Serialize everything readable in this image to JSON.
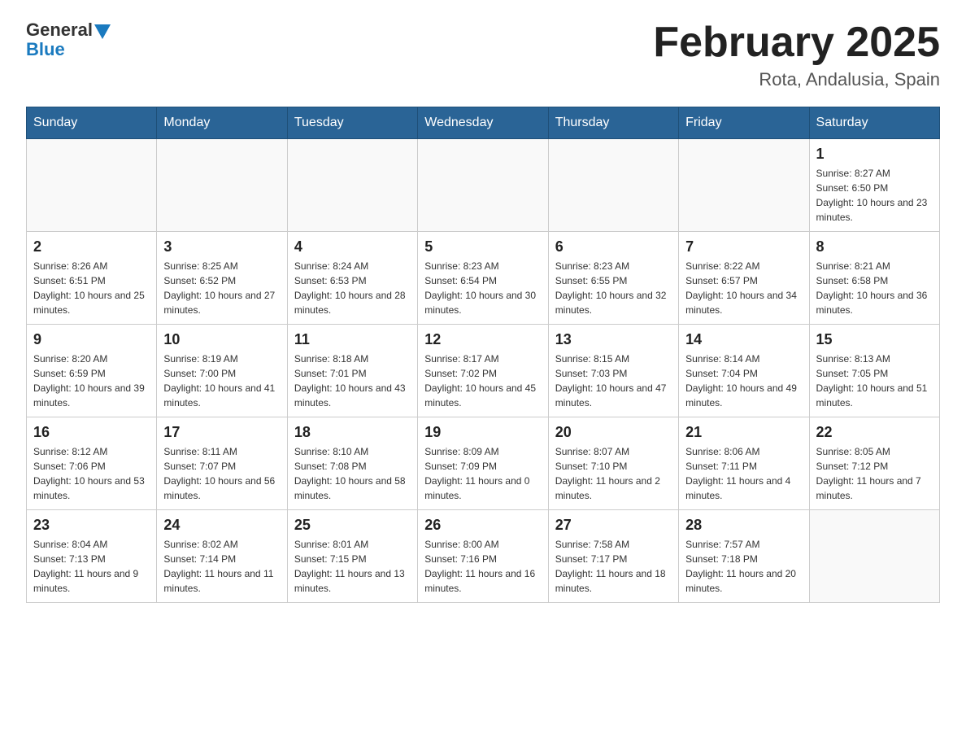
{
  "header": {
    "logo_general": "General",
    "logo_blue": "Blue",
    "month_title": "February 2025",
    "location": "Rota, Andalusia, Spain"
  },
  "days_of_week": [
    "Sunday",
    "Monday",
    "Tuesday",
    "Wednesday",
    "Thursday",
    "Friday",
    "Saturday"
  ],
  "weeks": [
    [
      {
        "day": "",
        "info": ""
      },
      {
        "day": "",
        "info": ""
      },
      {
        "day": "",
        "info": ""
      },
      {
        "day": "",
        "info": ""
      },
      {
        "day": "",
        "info": ""
      },
      {
        "day": "",
        "info": ""
      },
      {
        "day": "1",
        "info": "Sunrise: 8:27 AM\nSunset: 6:50 PM\nDaylight: 10 hours and 23 minutes."
      }
    ],
    [
      {
        "day": "2",
        "info": "Sunrise: 8:26 AM\nSunset: 6:51 PM\nDaylight: 10 hours and 25 minutes."
      },
      {
        "day": "3",
        "info": "Sunrise: 8:25 AM\nSunset: 6:52 PM\nDaylight: 10 hours and 27 minutes."
      },
      {
        "day": "4",
        "info": "Sunrise: 8:24 AM\nSunset: 6:53 PM\nDaylight: 10 hours and 28 minutes."
      },
      {
        "day": "5",
        "info": "Sunrise: 8:23 AM\nSunset: 6:54 PM\nDaylight: 10 hours and 30 minutes."
      },
      {
        "day": "6",
        "info": "Sunrise: 8:23 AM\nSunset: 6:55 PM\nDaylight: 10 hours and 32 minutes."
      },
      {
        "day": "7",
        "info": "Sunrise: 8:22 AM\nSunset: 6:57 PM\nDaylight: 10 hours and 34 minutes."
      },
      {
        "day": "8",
        "info": "Sunrise: 8:21 AM\nSunset: 6:58 PM\nDaylight: 10 hours and 36 minutes."
      }
    ],
    [
      {
        "day": "9",
        "info": "Sunrise: 8:20 AM\nSunset: 6:59 PM\nDaylight: 10 hours and 39 minutes."
      },
      {
        "day": "10",
        "info": "Sunrise: 8:19 AM\nSunset: 7:00 PM\nDaylight: 10 hours and 41 minutes."
      },
      {
        "day": "11",
        "info": "Sunrise: 8:18 AM\nSunset: 7:01 PM\nDaylight: 10 hours and 43 minutes."
      },
      {
        "day": "12",
        "info": "Sunrise: 8:17 AM\nSunset: 7:02 PM\nDaylight: 10 hours and 45 minutes."
      },
      {
        "day": "13",
        "info": "Sunrise: 8:15 AM\nSunset: 7:03 PM\nDaylight: 10 hours and 47 minutes."
      },
      {
        "day": "14",
        "info": "Sunrise: 8:14 AM\nSunset: 7:04 PM\nDaylight: 10 hours and 49 minutes."
      },
      {
        "day": "15",
        "info": "Sunrise: 8:13 AM\nSunset: 7:05 PM\nDaylight: 10 hours and 51 minutes."
      }
    ],
    [
      {
        "day": "16",
        "info": "Sunrise: 8:12 AM\nSunset: 7:06 PM\nDaylight: 10 hours and 53 minutes."
      },
      {
        "day": "17",
        "info": "Sunrise: 8:11 AM\nSunset: 7:07 PM\nDaylight: 10 hours and 56 minutes."
      },
      {
        "day": "18",
        "info": "Sunrise: 8:10 AM\nSunset: 7:08 PM\nDaylight: 10 hours and 58 minutes."
      },
      {
        "day": "19",
        "info": "Sunrise: 8:09 AM\nSunset: 7:09 PM\nDaylight: 11 hours and 0 minutes."
      },
      {
        "day": "20",
        "info": "Sunrise: 8:07 AM\nSunset: 7:10 PM\nDaylight: 11 hours and 2 minutes."
      },
      {
        "day": "21",
        "info": "Sunrise: 8:06 AM\nSunset: 7:11 PM\nDaylight: 11 hours and 4 minutes."
      },
      {
        "day": "22",
        "info": "Sunrise: 8:05 AM\nSunset: 7:12 PM\nDaylight: 11 hours and 7 minutes."
      }
    ],
    [
      {
        "day": "23",
        "info": "Sunrise: 8:04 AM\nSunset: 7:13 PM\nDaylight: 11 hours and 9 minutes."
      },
      {
        "day": "24",
        "info": "Sunrise: 8:02 AM\nSunset: 7:14 PM\nDaylight: 11 hours and 11 minutes."
      },
      {
        "day": "25",
        "info": "Sunrise: 8:01 AM\nSunset: 7:15 PM\nDaylight: 11 hours and 13 minutes."
      },
      {
        "day": "26",
        "info": "Sunrise: 8:00 AM\nSunset: 7:16 PM\nDaylight: 11 hours and 16 minutes."
      },
      {
        "day": "27",
        "info": "Sunrise: 7:58 AM\nSunset: 7:17 PM\nDaylight: 11 hours and 18 minutes."
      },
      {
        "day": "28",
        "info": "Sunrise: 7:57 AM\nSunset: 7:18 PM\nDaylight: 11 hours and 20 minutes."
      },
      {
        "day": "",
        "info": ""
      }
    ]
  ]
}
